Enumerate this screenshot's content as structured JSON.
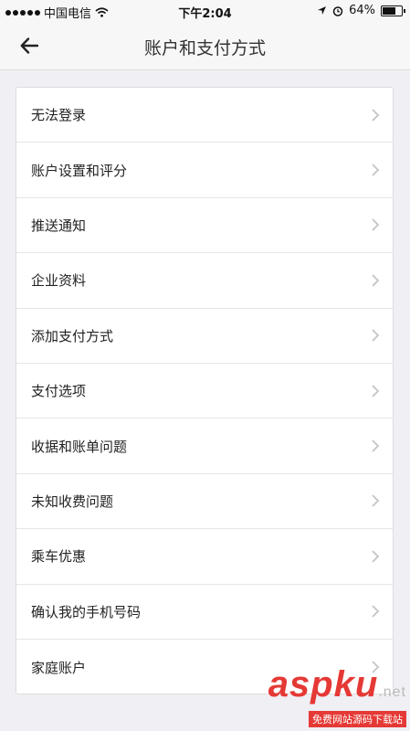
{
  "status_bar": {
    "carrier": "中国电信",
    "time": "下午2:04",
    "battery": "64%"
  },
  "nav": {
    "title": "账户和支付方式"
  },
  "menu": {
    "items": [
      {
        "label": "无法登录"
      },
      {
        "label": "账户设置和评分"
      },
      {
        "label": "推送通知"
      },
      {
        "label": "企业资料"
      },
      {
        "label": "添加支付方式"
      },
      {
        "label": "支付选项"
      },
      {
        "label": "收据和账单问题"
      },
      {
        "label": "未知收费问题"
      },
      {
        "label": "乘车优惠"
      },
      {
        "label": "确认我的手机号码"
      },
      {
        "label": "家庭账户"
      }
    ]
  },
  "watermark": {
    "logo": "asp",
    "logo2": "ku",
    "domain": ".net",
    "tagline": "免费网站源码下载站"
  },
  "colors": {
    "background": "#efeff4",
    "watermark_red": "#e53935"
  }
}
